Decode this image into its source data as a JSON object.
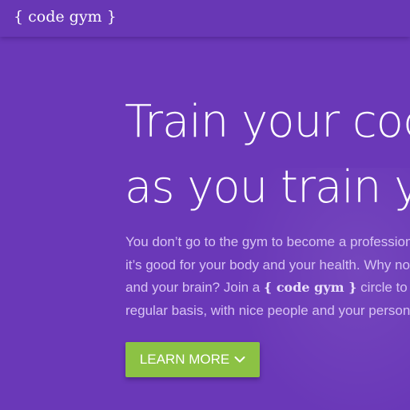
{
  "nav": {
    "logo": "{ code gym }"
  },
  "hero": {
    "title_line1": "Train your code",
    "title_line2": "as you train your",
    "body_line1": "You don’t go to the gym to become a professional",
    "body_line2": "it’s good for your body and your health. Why not",
    "body_line3_prefix": "and your brain? Join a ",
    "body_line3_logo": "{ code gym }",
    "body_line3_suffix": " circle to",
    "body_line4": "regular basis, with nice people and your personal",
    "cta_label": "LEARN MORE",
    "cta_icon": "chevron-down-icon"
  },
  "colors": {
    "background": "#6a38b8",
    "navbar": "#6837b5",
    "body_text": "#d8c4f4",
    "button": "#8cc244"
  }
}
